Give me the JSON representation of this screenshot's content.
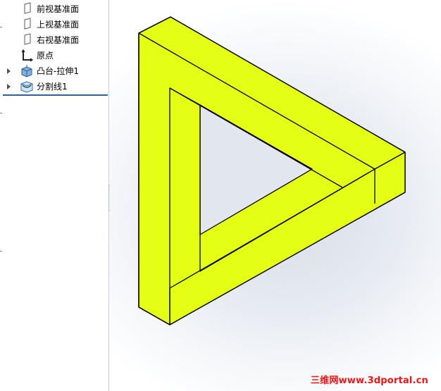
{
  "feature_tree": {
    "items": [
      {
        "label": "前视基准面",
        "icon": "plane-icon",
        "expandable": false
      },
      {
        "label": "上视基准面",
        "icon": "plane-icon",
        "expandable": false
      },
      {
        "label": "右视基准面",
        "icon": "plane-icon",
        "expandable": false
      },
      {
        "label": "原点",
        "icon": "origin-icon",
        "expandable": false
      },
      {
        "label": "凸台-拉伸1",
        "icon": "boss-extrude-icon",
        "expandable": true
      },
      {
        "label": "分割线1",
        "icon": "split-line-icon",
        "expandable": true
      }
    ]
  },
  "model": {
    "name": "impossible-triangle",
    "face_color": "#e5ff14",
    "edge_color": "#000000"
  },
  "watermark": {
    "text": "三维网www.3dportal.cn",
    "color": "#ff1010"
  }
}
